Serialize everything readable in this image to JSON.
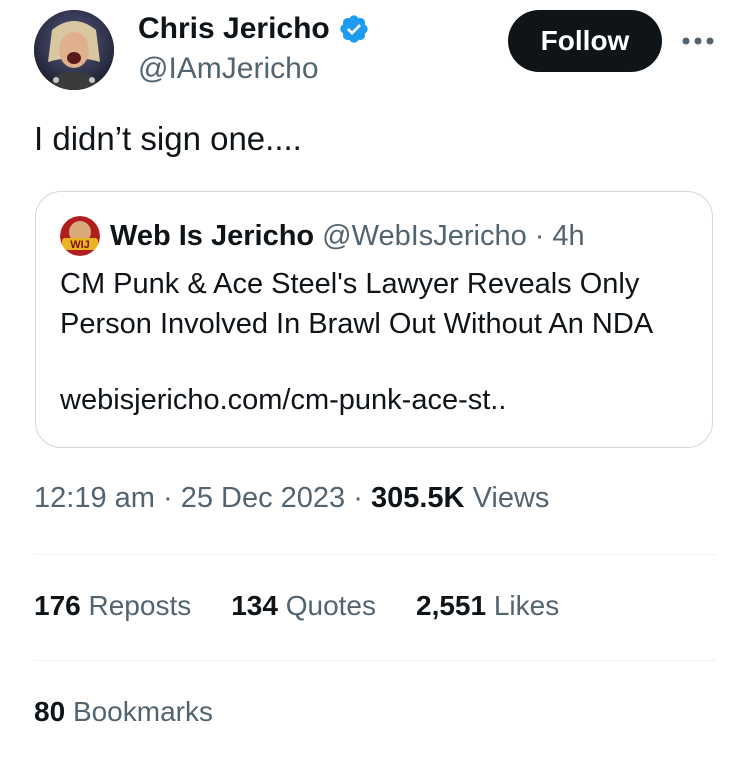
{
  "author": {
    "name": "Chris Jericho",
    "handle": "@IAmJericho",
    "verified": true
  },
  "actions": {
    "follow_label": "Follow",
    "more_icon": "more-horizontal-icon"
  },
  "tweet": {
    "text": "I didn’t sign one...."
  },
  "quote": {
    "name": "Web Is Jericho",
    "handle": "@WebIsJericho",
    "separator": "·",
    "time": "4h",
    "text": "CM Punk & Ace Steel's Lawyer Reveals Only Person Involved In Brawl Out Without An NDA",
    "link": "webisjericho.com/cm-punk-ace-st..",
    "avatar_text": "WIJ"
  },
  "meta": {
    "time": "12:19 am",
    "sep1": "·",
    "date": "25 Dec 2023",
    "sep2": "·",
    "views_count": "305.5K",
    "views_label": "Views"
  },
  "stats": {
    "reposts_count": "176",
    "reposts_label": "Reposts",
    "quotes_count": "134",
    "quotes_label": "Quotes",
    "likes_count": "2,551",
    "likes_label": "Likes",
    "bookmarks_count": "80",
    "bookmarks_label": "Bookmarks"
  },
  "colors": {
    "text_primary": "#0f1419",
    "text_secondary": "#536471",
    "verified_blue": "#1d9bf0",
    "border": "#cfd9de",
    "divider": "#eff3f4",
    "button_bg": "#0f1419"
  }
}
